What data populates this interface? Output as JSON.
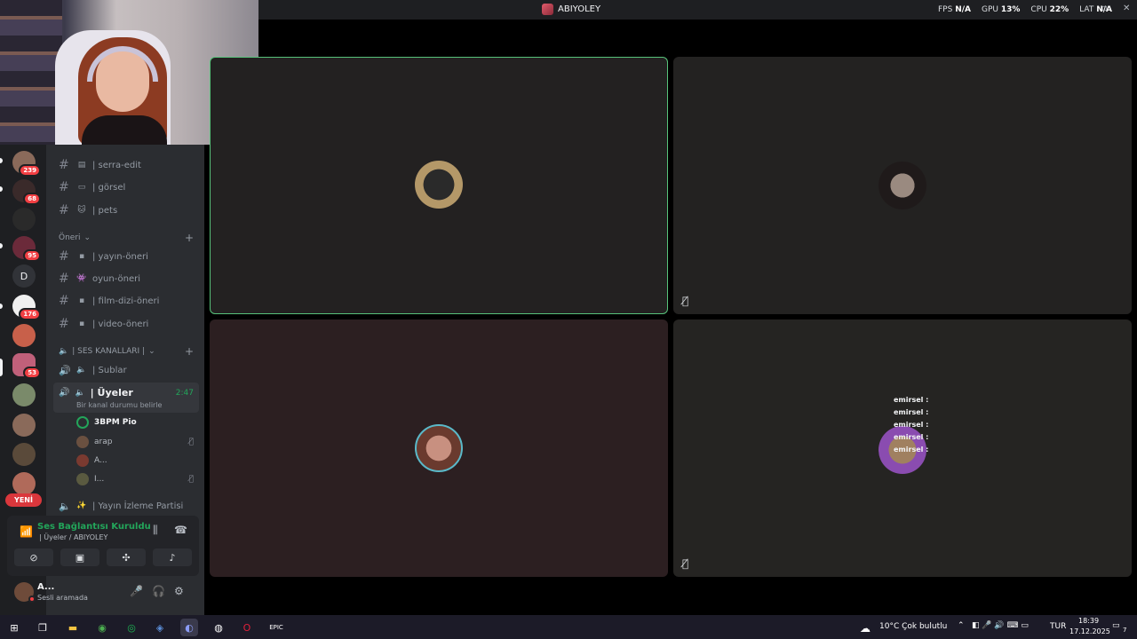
{
  "window": {
    "title": "ABIYOLEY",
    "stats": {
      "fps_label": "FPS",
      "fps_value": "N/A",
      "gpu_label": "GPU",
      "gpu_value": "13%",
      "cpu_label": "CPU",
      "cpu_value": "22%",
      "lat_label": "LAT",
      "lat_value": "N/A"
    }
  },
  "servers": [
    {
      "badge": "239"
    },
    {
      "badge": "68"
    },
    {
      "badge": ""
    },
    {
      "badge": "95"
    },
    {
      "letter": "D"
    },
    {
      "badge": "176"
    },
    {
      "badge": ""
    },
    {
      "badge": "53"
    },
    {
      "badge": ""
    },
    {
      "badge": ""
    },
    {
      "badge": ""
    },
    {
      "badge": ""
    }
  ],
  "new_label": "YENİ",
  "channels": {
    "top": [
      {
        "emoji": "▤",
        "name": "| serra-edit"
      },
      {
        "emoji": "▭",
        "name": "| görsel"
      },
      {
        "emoji": "🐱",
        "name": "| pets"
      }
    ],
    "category_oneri": "Öneri",
    "oneri": [
      {
        "emoji": "▪",
        "name": "| yayın-öneri"
      },
      {
        "emoji": "👾",
        "name": "oyun-öneri"
      },
      {
        "emoji": "▪",
        "name": "| film-dizi-öneri"
      },
      {
        "emoji": "▪",
        "name": "| video-öneri"
      }
    ],
    "category_voice": "| SES KANALLARI |",
    "voice": [
      {
        "name": "| Sublar"
      }
    ],
    "active_voice": {
      "name": "| Üyeler",
      "time": "2:47",
      "status": "Bir kanal durumu belirle"
    },
    "members": [
      {
        "name": "3BPM Pio",
        "muted": false
      },
      {
        "name": "arap",
        "muted": true
      },
      {
        "name": "A...",
        "muted": false
      },
      {
        "name": "I...",
        "muted": true
      }
    ],
    "after": [
      {
        "emoji": "✨",
        "name": "| Yayın İzleme Partisi"
      }
    ]
  },
  "voice_panel": {
    "status": "Ses Bağlantısı Kuruldu",
    "channel": "| Üyeler / ABIYOLEY"
  },
  "user": {
    "name": "A...",
    "status": "Sesli aramada"
  },
  "chat_overlay": [
    "emirsel :",
    "emirsel :",
    "emirsel :",
    "emirsel :",
    "emirsel :"
  ],
  "taskbar": {
    "weather": "10°C  Çok bulutlu",
    "lang": "TUR",
    "time": "18:39",
    "date": "17.12.2025",
    "notif": "7"
  },
  "colors": {
    "accent_green": "#23a55a",
    "speaking_border": "#57c27a",
    "danger": "#f23f43"
  }
}
